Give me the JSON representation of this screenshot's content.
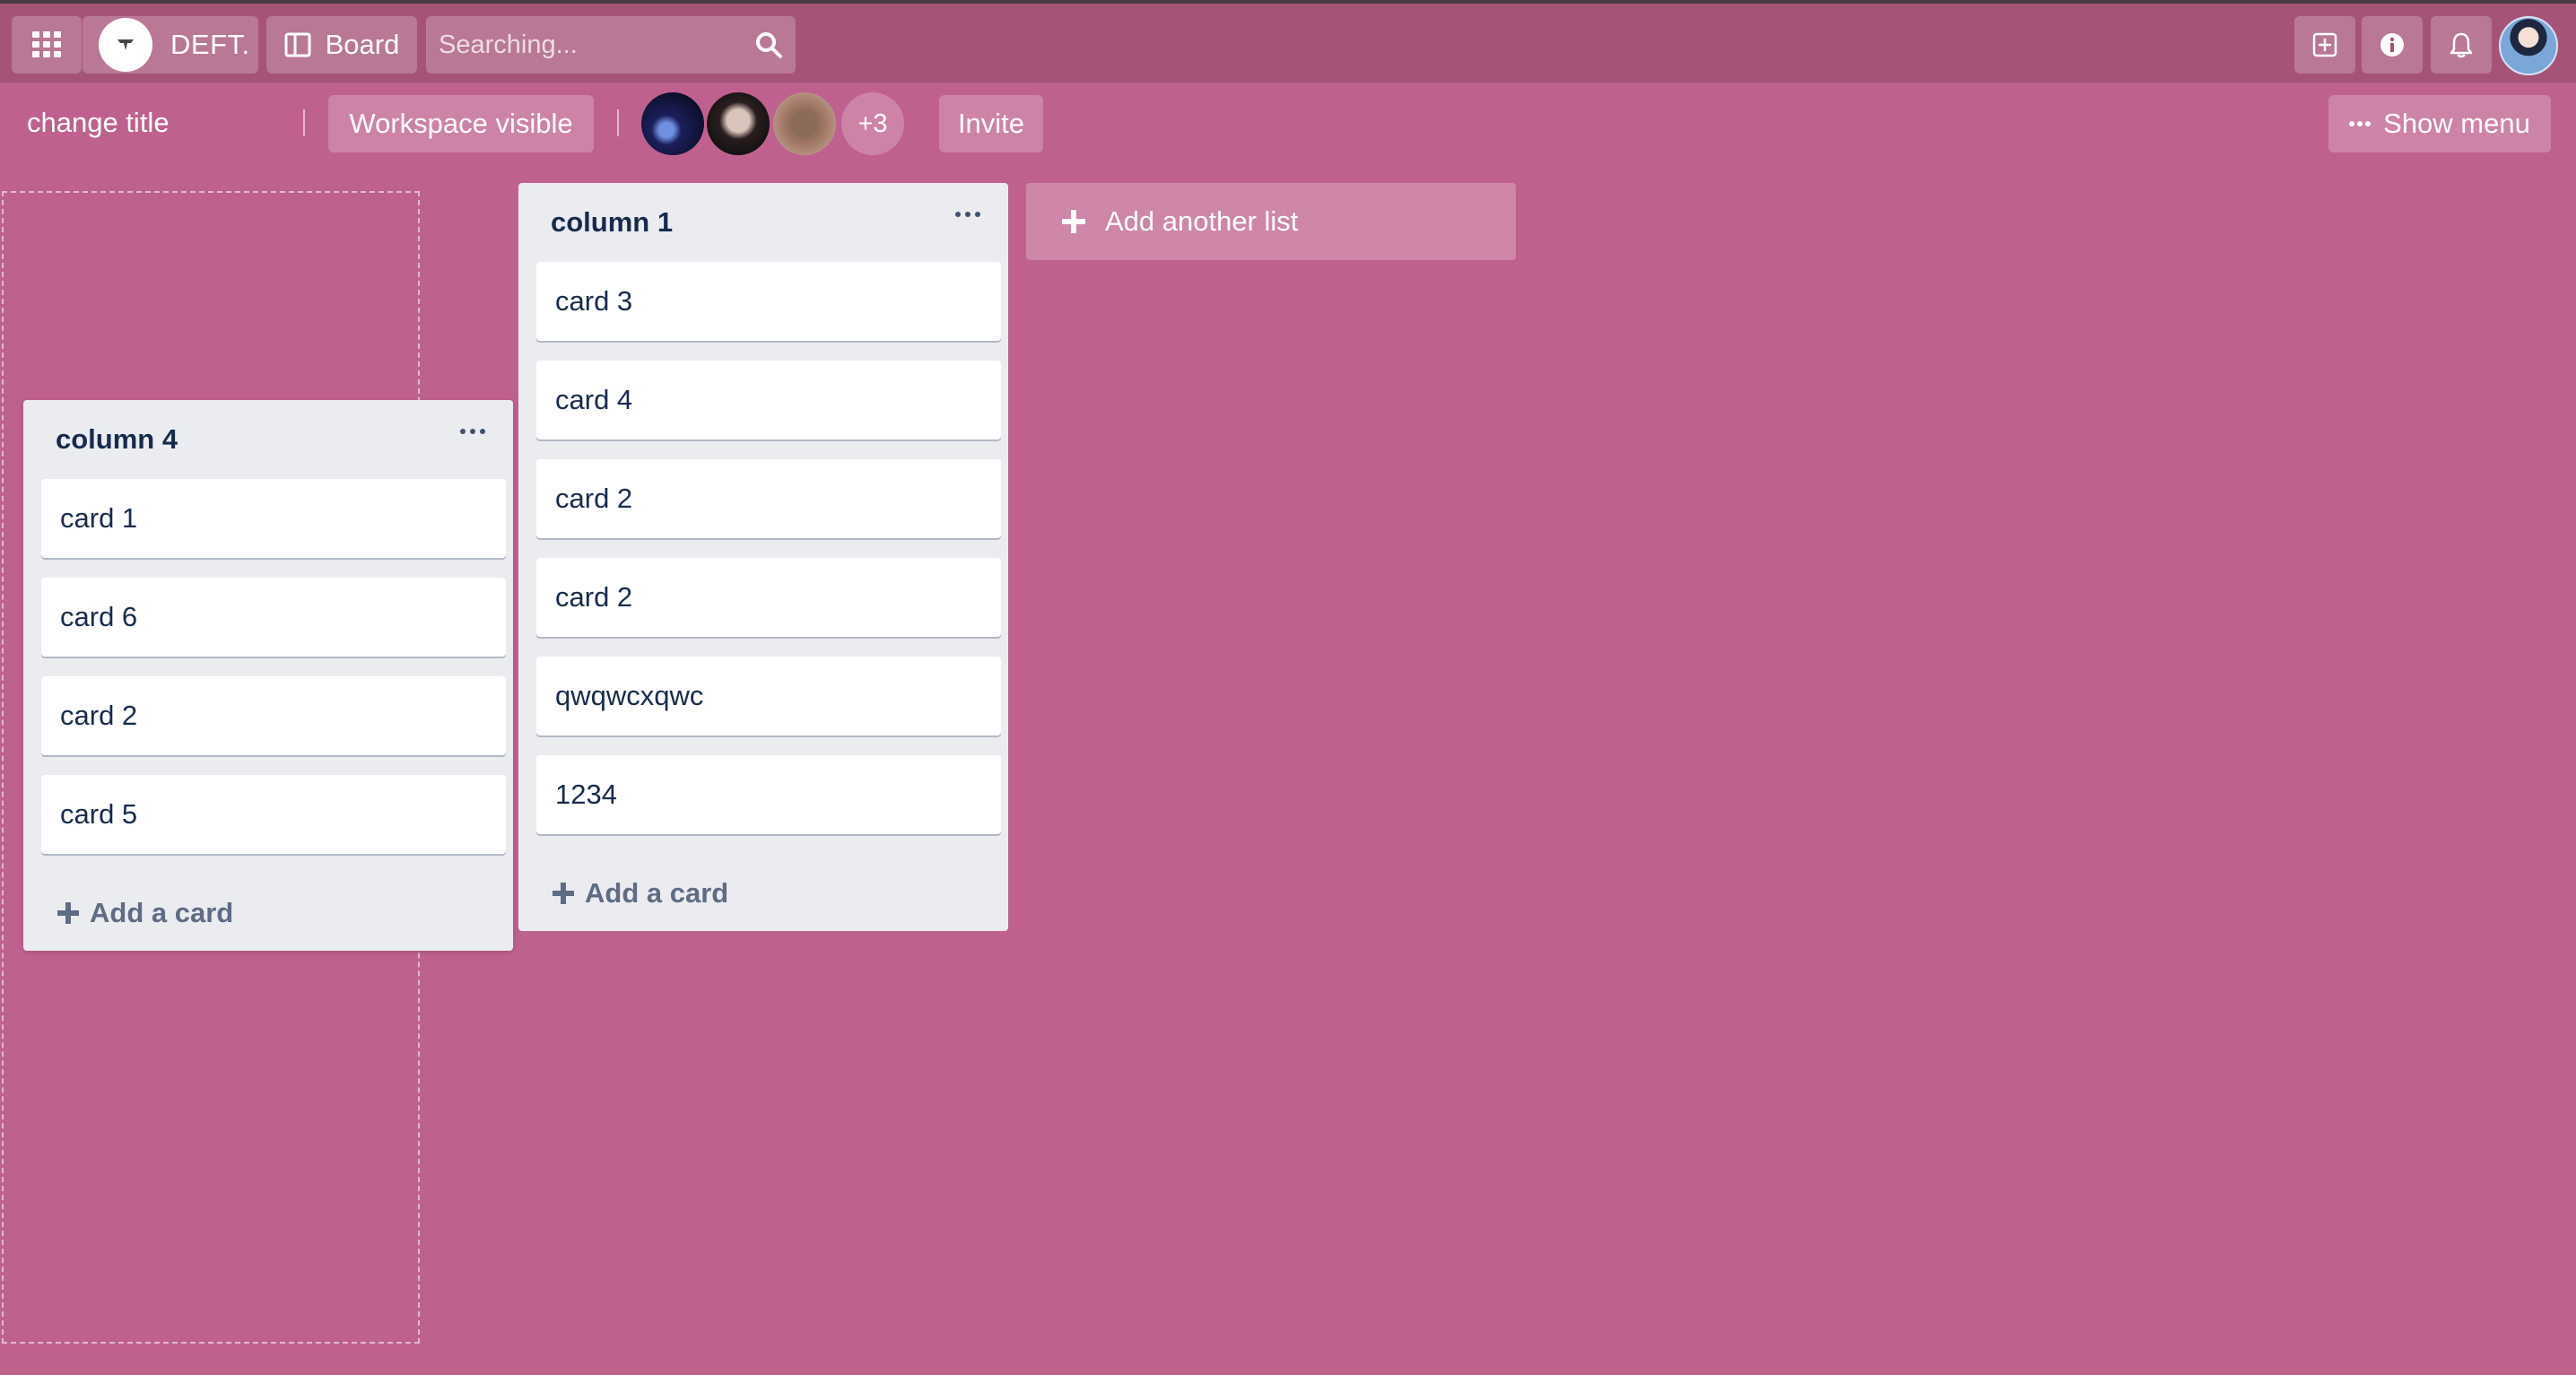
{
  "navbar": {
    "logo_text": "DEFT.",
    "board_label": "Board",
    "search_placeholder": "Searching..."
  },
  "board": {
    "title": "change title",
    "workspace_visibility": "Workspace visible",
    "members_more": "+3",
    "invite_label": "Invite",
    "show_menu_label": "Show menu"
  },
  "lists": {
    "column4": {
      "title": "column 4",
      "cards": [
        "card 1",
        "card 6",
        "card 2",
        "card 5"
      ],
      "add_card_label": "Add a card"
    },
    "column1": {
      "title": "column 1",
      "cards": [
        "card 3",
        "card 4",
        "card 2",
        "card 2",
        "qwqwcxqwc",
        "1234"
      ],
      "add_card_label": "Add a card"
    }
  },
  "add_list_label": "Add another list",
  "colors": {
    "board_bg": "#bf618f",
    "navbar_bg": "#a65378",
    "list_bg": "#ebecf0"
  },
  "icons": [
    "apps-grid-icon",
    "logo-icon",
    "board-icon",
    "search-icon",
    "add-icon",
    "info-icon",
    "bell-icon",
    "more-dots-icon",
    "plus-icon"
  ]
}
